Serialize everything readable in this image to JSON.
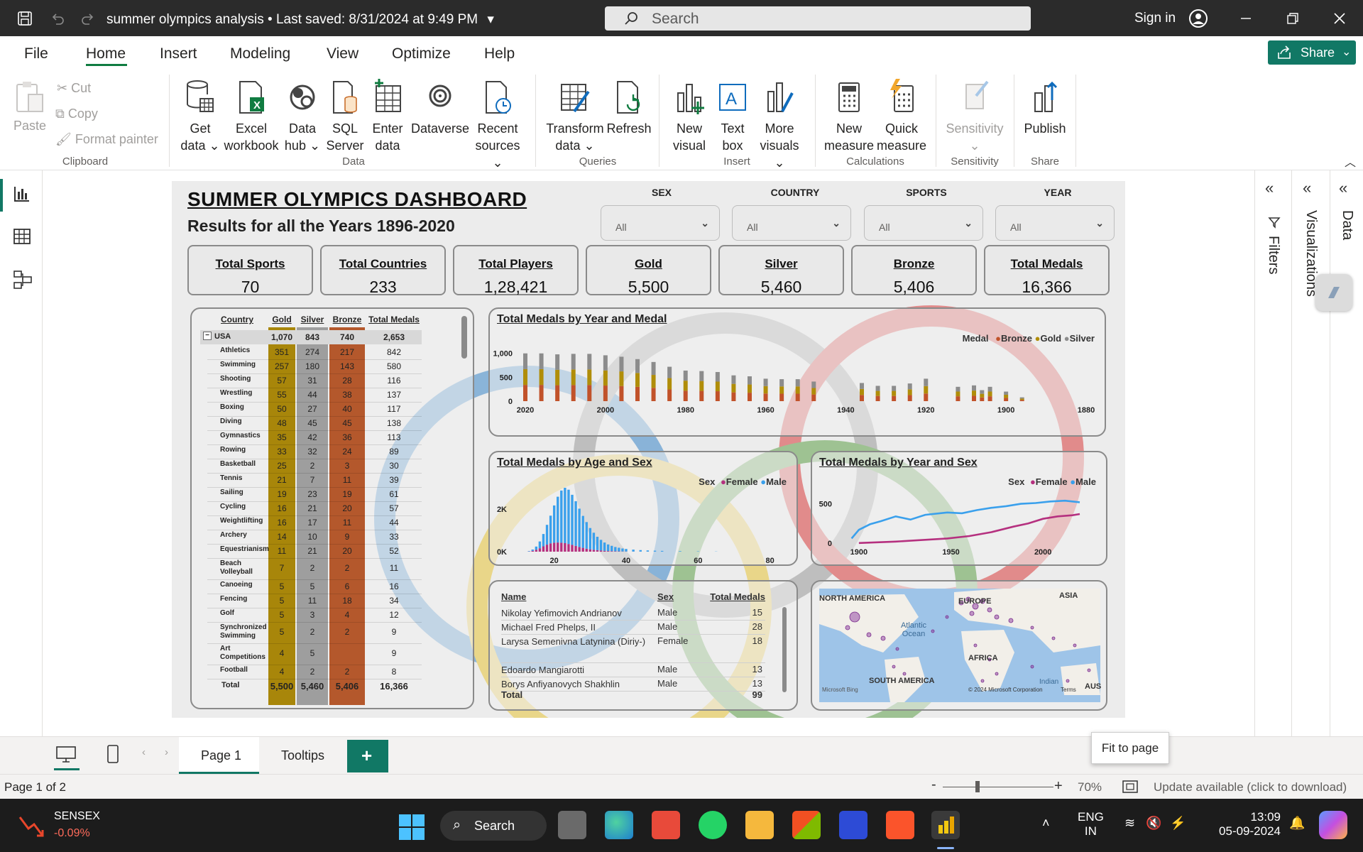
{
  "app": {
    "doc_title": "summer olympics analysis",
    "saved_status": "Last saved: 8/31/2024 at 9:49 PM",
    "search_placeholder": "Search",
    "sign_in": "Sign in",
    "share": "Share",
    "accent_color": "#117865"
  },
  "menu": [
    "File",
    "Home",
    "Insert",
    "Modeling",
    "View",
    "Optimize",
    "Help"
  ],
  "ribbon": {
    "clipboard": {
      "paste": "Paste",
      "cut": "Cut",
      "copy": "Copy",
      "format_painter": "Format painter",
      "group": "Clipboard"
    },
    "data": {
      "get_data_1": "Get",
      "get_data_2": "data",
      "excel_1": "Excel",
      "excel_2": "workbook",
      "hub_1": "Data",
      "hub_2": "hub",
      "sql_1": "SQL",
      "sql_2": "Server",
      "enter_1": "Enter",
      "enter_2": "data",
      "dataverse": "Dataverse",
      "recent_1": "Recent",
      "recent_2": "sources",
      "group": "Data"
    },
    "queries": {
      "transform_1": "Transform",
      "transform_2": "data",
      "refresh": "Refresh",
      "group": "Queries"
    },
    "insert": {
      "new_visual_1": "New",
      "new_visual_2": "visual",
      "text_box_1": "Text",
      "text_box_2": "box",
      "more_1": "More",
      "more_2": "visuals",
      "group": "Insert"
    },
    "calculations": {
      "new_measure_1": "New",
      "new_measure_2": "measure",
      "quick_measure_1": "Quick",
      "quick_measure_2": "measure",
      "group": "Calculations"
    },
    "sensitivity": {
      "label": "Sensitivity",
      "group": "Sensitivity"
    },
    "share": {
      "publish": "Publish",
      "group": "Share"
    }
  },
  "panes": {
    "filters": "Filters",
    "visualizations": "Visualizations",
    "data": "Data"
  },
  "dashboard": {
    "title": "SUMMER OLYMPICS DASHBOARD",
    "subtitle": "Results for all the Years 1896-2020",
    "slicers": [
      {
        "label": "SEX",
        "value": "All"
      },
      {
        "label": "COUNTRY",
        "value": "All"
      },
      {
        "label": "SPORTS",
        "value": "All"
      },
      {
        "label": "YEAR",
        "value": "All"
      }
    ],
    "kpis": [
      {
        "label": "Total Sports",
        "value": "70"
      },
      {
        "label": "Total Countries",
        "value": "233"
      },
      {
        "label": "Total Players",
        "value": "1,28,421"
      },
      {
        "label": "Gold",
        "value": "5,500"
      },
      {
        "label": "Silver",
        "value": "5,460"
      },
      {
        "label": "Bronze",
        "value": "5,406"
      },
      {
        "label": "Total Medals",
        "value": "16,366"
      }
    ],
    "matrix": {
      "headers": [
        "Country",
        "Gold",
        "Silver",
        "Bronze",
        "Total Medals"
      ],
      "country": "USA",
      "country_values": [
        "1,070",
        "843",
        "740",
        "2,653"
      ],
      "rows": [
        [
          "Athletics",
          "351",
          "274",
          "217",
          "842"
        ],
        [
          "Swimming",
          "257",
          "180",
          "143",
          "580"
        ],
        [
          "Shooting",
          "57",
          "31",
          "28",
          "116"
        ],
        [
          "Wrestling",
          "55",
          "44",
          "38",
          "137"
        ],
        [
          "Boxing",
          "50",
          "27",
          "40",
          "117"
        ],
        [
          "Diving",
          "48",
          "45",
          "45",
          "138"
        ],
        [
          "Gymnastics",
          "35",
          "42",
          "36",
          "113"
        ],
        [
          "Rowing",
          "33",
          "32",
          "24",
          "89"
        ],
        [
          "Basketball",
          "25",
          "2",
          "3",
          "30"
        ],
        [
          "Tennis",
          "21",
          "7",
          "11",
          "39"
        ],
        [
          "Sailing",
          "19",
          "23",
          "19",
          "61"
        ],
        [
          "Cycling",
          "16",
          "21",
          "20",
          "57"
        ],
        [
          "Weightlifting",
          "16",
          "17",
          "11",
          "44"
        ],
        [
          "Archery",
          "14",
          "10",
          "9",
          "33"
        ],
        [
          "Equestrianism",
          "11",
          "21",
          "20",
          "52"
        ],
        [
          "Beach Volleyball",
          "7",
          "2",
          "2",
          "11"
        ],
        [
          "Canoeing",
          "5",
          "5",
          "6",
          "16"
        ],
        [
          "Fencing",
          "5",
          "11",
          "18",
          "34"
        ],
        [
          "Golf",
          "5",
          "3",
          "4",
          "12"
        ],
        [
          "Synchronized Swimming",
          "5",
          "2",
          "2",
          "9"
        ],
        [
          "Art Competitions",
          "4",
          "5",
          "",
          "9"
        ],
        [
          "Football",
          "4",
          "2",
          "2",
          "8"
        ]
      ],
      "total_label": "Total",
      "total_values": [
        "5,500",
        "5,460",
        "5,406",
        "16,366"
      ],
      "colors": {
        "gold": "#a8860a",
        "silver": "#9e9e9e",
        "bronze": "#b4582c"
      }
    },
    "names_table": {
      "headers": [
        "Name",
        "Sex",
        "Total Medals"
      ],
      "rows": [
        [
          "Nikolay Yefimovich Andrianov",
          "Male",
          "15"
        ],
        [
          "Michael Fred Phelps, II",
          "Male",
          "28"
        ],
        [
          "Larysa Semenivna Latynina (Diriy-)",
          "Female",
          "18"
        ],
        [
          "Edoardo Mangiarotti",
          "Male",
          "13"
        ],
        [
          "Borys Anfiyanovych Shakhlin",
          "Male",
          "13"
        ]
      ],
      "total_label": "Total",
      "total_value": "99"
    },
    "map": {
      "labels": [
        "NORTH AMERICA",
        "EUROPE",
        "ASIA",
        "Atlantic Ocean",
        "AFRICA",
        "SOUTH AMERICA",
        "Indian",
        "AUS"
      ],
      "credit": "© 2024 Microsoft Corporation",
      "terms": "Terms",
      "bing": "Microsoft Bing"
    }
  },
  "chart_data": [
    {
      "type": "bar",
      "title": "Total Medals by Year and Medal",
      "legend_title": "Medal",
      "series": [
        {
          "name": "Bronze",
          "color": "#c1522a"
        },
        {
          "name": "Gold",
          "color": "#b08d09"
        },
        {
          "name": "Silver",
          "color": "#8c8c8c"
        }
      ],
      "x_ticks": [
        "2020",
        "2000",
        "1980",
        "1960",
        "1940",
        "1920",
        "1900",
        "1880"
      ],
      "y_ticks": [
        "0",
        "500",
        "1,000"
      ],
      "ylim": [
        0,
        1100
      ],
      "years": [
        2020,
        2016,
        2012,
        2008,
        2004,
        2000,
        1996,
        1992,
        1988,
        1984,
        1980,
        1976,
        1972,
        1968,
        1964,
        1960,
        1956,
        1952,
        1948,
        1936,
        1932,
        1928,
        1924,
        1920,
        1912,
        1908,
        1906,
        1904,
        1900,
        1896
      ],
      "totals": [
        1000,
        1000,
        980,
        990,
        990,
        960,
        930,
        880,
        820,
        720,
        640,
        630,
        610,
        540,
        520,
        470,
        460,
        460,
        410,
        380,
        320,
        320,
        370,
        470,
        300,
        330,
        230,
        300,
        200,
        80
      ]
    },
    {
      "type": "bar",
      "title": "Total Medals by Age and Sex",
      "legend_title": "Sex",
      "series": [
        {
          "name": "Female",
          "color": "#b5307f"
        },
        {
          "name": "Male",
          "color": "#3aa0ec"
        }
      ],
      "x_ticks": [
        "20",
        "40",
        "60",
        "80"
      ],
      "y_ticks": [
        "0K",
        "2K"
      ],
      "xlim": [
        10,
        85
      ],
      "ylim": [
        0,
        3000
      ],
      "ages": [
        13,
        14,
        15,
        16,
        17,
        18,
        19,
        20,
        21,
        22,
        23,
        24,
        25,
        26,
        27,
        28,
        29,
        30,
        31,
        32,
        33,
        34,
        35,
        36,
        37,
        38,
        39,
        40,
        42,
        44,
        46,
        48,
        50,
        55,
        60,
        65
      ],
      "female": [
        10,
        40,
        90,
        160,
        250,
        330,
        390,
        420,
        430,
        420,
        400,
        360,
        320,
        270,
        220,
        180,
        140,
        110,
        90,
        70,
        55,
        40,
        30,
        25,
        20,
        15,
        10,
        8,
        6,
        4,
        3,
        2,
        2,
        1,
        1,
        0
      ],
      "male": [
        20,
        60,
        150,
        320,
        580,
        930,
        1300,
        1750,
        2150,
        2450,
        2600,
        2550,
        2350,
        2100,
        1800,
        1500,
        1250,
        1000,
        800,
        630,
        500,
        390,
        310,
        250,
        200,
        170,
        140,
        120,
        90,
        70,
        55,
        45,
        35,
        25,
        15,
        8
      ]
    },
    {
      "type": "line",
      "title": "Total Medals by Year and Sex",
      "legend_title": "Sex",
      "series": [
        {
          "name": "Female",
          "color": "#b5307f",
          "x": [
            1900,
            1920,
            1948,
            1960,
            1972,
            1984,
            1992,
            2000,
            2008,
            2016,
            2020
          ],
          "y": [
            2,
            20,
            60,
            90,
            140,
            210,
            250,
            310,
            340,
            355,
            370
          ]
        },
        {
          "name": "Male",
          "color": "#3aa0ec",
          "x": [
            1896,
            1900,
            1906,
            1912,
            1920,
            1928,
            1936,
            1948,
            1956,
            1964,
            1972,
            1980,
            1988,
            1996,
            2004,
            2012,
            2020
          ],
          "y": [
            60,
            170,
            240,
            280,
            340,
            300,
            360,
            390,
            380,
            420,
            450,
            470,
            500,
            510,
            530,
            540,
            520
          ]
        }
      ],
      "x_ticks": [
        "1900",
        "1950",
        "2000"
      ],
      "y_ticks": [
        "0",
        "500"
      ],
      "xlim": [
        1890,
        2025
      ],
      "ylim": [
        0,
        650
      ]
    }
  ],
  "bottom": {
    "tabs": [
      "Page 1",
      "Tooltips"
    ],
    "add_tab": "+",
    "page_status": "Page 1 of 2",
    "zoom": "70%",
    "update": "Update available (click to download)",
    "tooltip": "Fit to page"
  },
  "taskbar": {
    "ticker": "SENSEX",
    "ticker_change": "-0.09%",
    "search": "Search",
    "lang1": "ENG",
    "lang2": "IN",
    "time": "13:09",
    "date": "05-09-2024"
  }
}
